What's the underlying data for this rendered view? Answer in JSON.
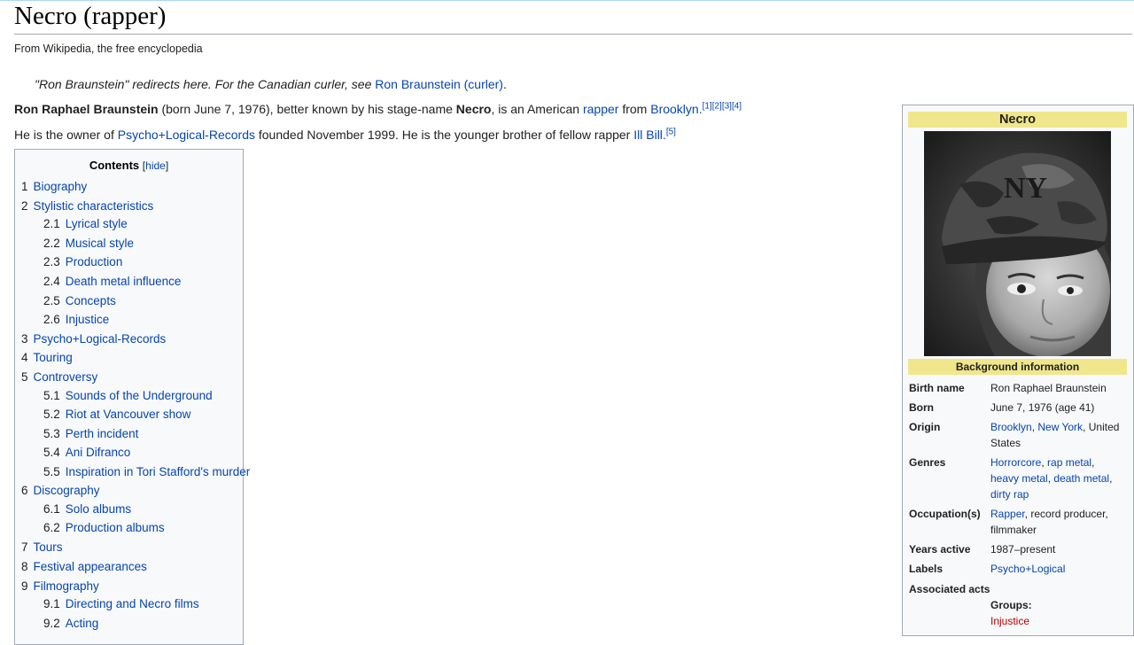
{
  "title": "Necro (rapper)",
  "tagline": "From Wikipedia, the free encyclopedia",
  "hatnote": {
    "text": "\"Ron Braunstein\" redirects here. For the Canadian curler, see ",
    "link": "Ron Braunstein (curler)",
    "end": "."
  },
  "intro": {
    "p1": {
      "name": "Ron Raphael Braunstein",
      "t1": " (born June 7, 1976), better known by his stage-name ",
      "stage": "Necro",
      "t2": ", is an American ",
      "link1": "rapper",
      "t3": " from ",
      "link2": "Brooklyn",
      "t4": ".",
      "refs": [
        "[1]",
        "[2]",
        "[3]",
        "[4]"
      ]
    },
    "p2": {
      "t1": "He is the owner of ",
      "link1": "Psycho+Logical-Records",
      "t2": " founded November 1999. He is the younger brother of fellow rapper ",
      "link2": "Ill Bill",
      "t3": ".",
      "ref": "[5]"
    }
  },
  "toc": {
    "title": "Contents",
    "hide_open": "[",
    "hide_label": "hide",
    "hide_close": "]",
    "items": [
      {
        "num": "1",
        "label": "Biography"
      },
      {
        "num": "2",
        "label": "Stylistic characteristics"
      },
      {
        "num": "2.1",
        "label": "Lyrical style"
      },
      {
        "num": "2.2",
        "label": "Musical style"
      },
      {
        "num": "2.3",
        "label": "Production"
      },
      {
        "num": "2.4",
        "label": "Death metal influence"
      },
      {
        "num": "2.5",
        "label": "Concepts"
      },
      {
        "num": "2.6",
        "label": "Injustice"
      },
      {
        "num": "3",
        "label": "Psycho+Logical-Records"
      },
      {
        "num": "4",
        "label": "Touring"
      },
      {
        "num": "5",
        "label": "Controversy"
      },
      {
        "num": "5.1",
        "label": "Sounds of the Underground"
      },
      {
        "num": "5.2",
        "label": "Riot at Vancouver show"
      },
      {
        "num": "5.3",
        "label": "Perth incident"
      },
      {
        "num": "5.4",
        "label": "Ani Difranco"
      },
      {
        "num": "5.5",
        "label": "Inspiration in Tori Stafford's murder"
      },
      {
        "num": "6",
        "label": "Discography"
      },
      {
        "num": "6.1",
        "label": "Solo albums"
      },
      {
        "num": "6.2",
        "label": "Production albums"
      },
      {
        "num": "7",
        "label": "Tours"
      },
      {
        "num": "8",
        "label": "Festival appearances"
      },
      {
        "num": "9",
        "label": "Filmography"
      },
      {
        "num": "9.1",
        "label": "Directing and Necro films"
      },
      {
        "num": "9.2",
        "label": "Acting"
      }
    ]
  },
  "infobox": {
    "title": "Necro",
    "section": "Background information",
    "birth_name": {
      "label": "Birth name",
      "value": "Ron Raphael Braunstein"
    },
    "born": {
      "label": "Born",
      "value": "June 7, 1976 (age 41)"
    },
    "origin": {
      "label": "Origin",
      "link1": "Brooklyn",
      "sep": ", ",
      "link2": "New York",
      "line1_rest": ", United",
      "line2": "States"
    },
    "genres": {
      "label": "Genres",
      "g1": "Horrorcore",
      "g2": "rap metal",
      "g3": "heavy metal",
      "g4": "death metal",
      "g5": "dirty rap",
      "comma": ","
    },
    "occupation": {
      "label": "Occupation(s)",
      "link": "Rapper",
      "rest": ", record producer,",
      "line2": "filmmaker"
    },
    "years_active": {
      "label": "Years active",
      "value": "1987–present"
    },
    "labels": {
      "label": "Labels",
      "link": "Psycho+Logical"
    },
    "associated": {
      "label": "Associated acts",
      "groups": "Groups:",
      "group1": "Injustice"
    }
  },
  "colors": {
    "link": "#0645ad",
    "redlink": "#ba0000",
    "infobox_header": "#f0e68c",
    "border": "#a2a9b1"
  }
}
